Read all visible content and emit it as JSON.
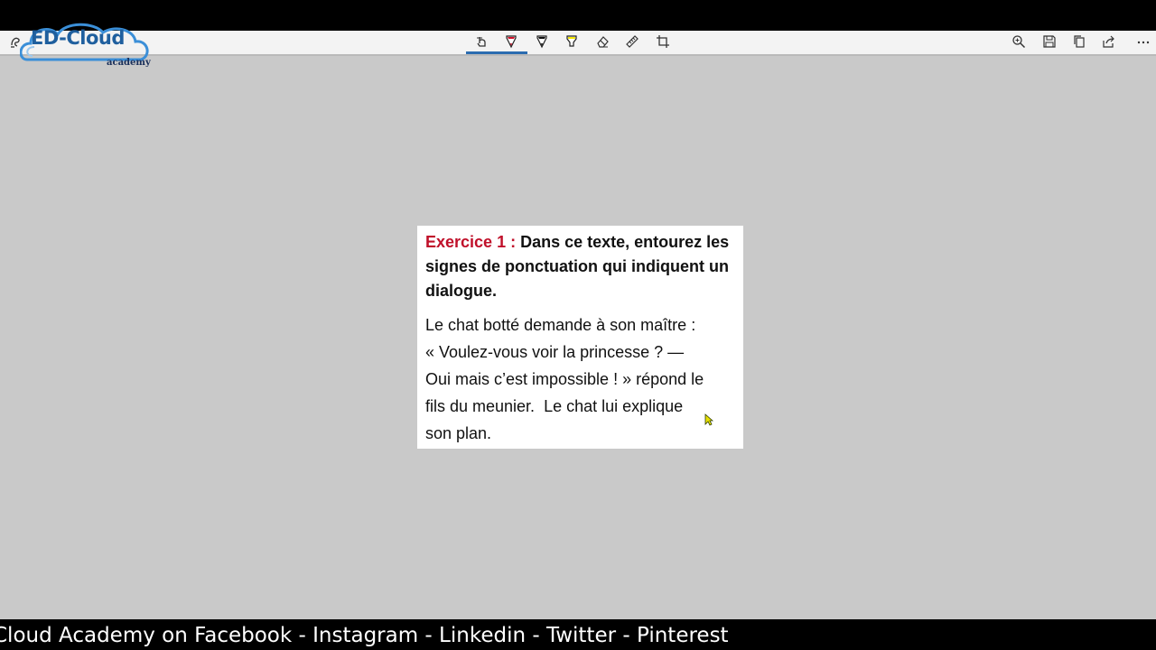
{
  "logo": {
    "brand": "ED-Cloud",
    "tagline": "academy"
  },
  "toolbar": {
    "left_tools": [
      "touch-writing-icon"
    ],
    "pen_tools": [
      "touch-pen-icon",
      "red-pen-icon",
      "black-pen-icon",
      "highlighter-icon",
      "eraser-icon",
      "ruler-icon",
      "crop-icon"
    ],
    "right_tools": [
      "zoom-icon",
      "save-icon",
      "copy-icon",
      "share-icon",
      "more-icon"
    ],
    "active_tool": "red-pen-icon",
    "colors": {
      "accent": "#2b6cb0",
      "red_pen": "#c0102a",
      "highlighter": "#f2e600"
    }
  },
  "exercise": {
    "label": "Exercice 1 :",
    "instruction": "Dans ce texte, entourez les signes de ponctuation qui indiquent un dialogue.",
    "body_lines": [
      "Le chat botté demande à son maître :",
      "« Voulez-vous voir la princesse ? —",
      "Oui mais c’est impossible ! » répond le",
      "fils du meunier.  Le chat lui explique",
      "son plan."
    ],
    "label_color": "#c0102a"
  },
  "footer": {
    "ticker": "Cloud Academy on Facebook - Instagram - Linkedin - Twitter - Pinterest"
  }
}
